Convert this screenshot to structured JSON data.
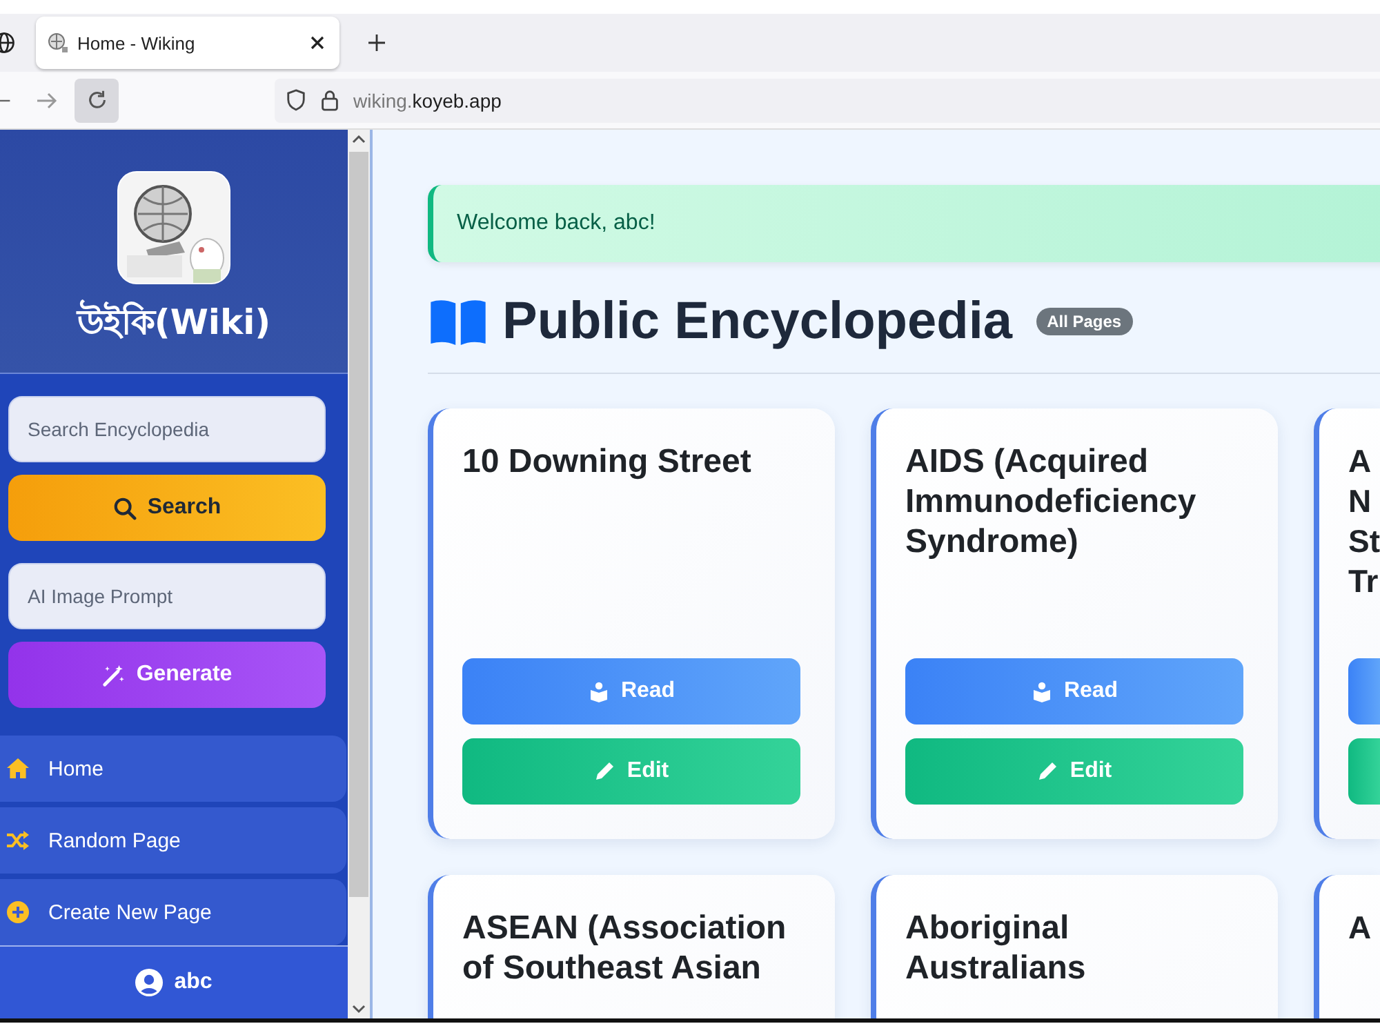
{
  "browser": {
    "tab": {
      "title": "Home - Wiking",
      "selected": true
    },
    "url": {
      "subdomain": "wiking.",
      "domain": "koyeb.app"
    }
  },
  "sidebar": {
    "title": "উইকি(Wiki)",
    "search": {
      "placeholder": "Search Encyclopedia"
    },
    "search_button": "Search",
    "prompt": {
      "placeholder": "AI Image Prompt"
    },
    "generate_button": "Generate",
    "nav": [
      {
        "kind": "home",
        "label": "Home"
      },
      {
        "kind": "random",
        "label": "Random Page"
      },
      {
        "kind": "create",
        "label": "Create New Page"
      }
    ],
    "user": "abc"
  },
  "main": {
    "alert": "Welcome back, abc!",
    "heading": "Public Encyclopedia",
    "badge": "All Pages",
    "cards": [
      {
        "title": "10 Downing Street",
        "buttons": [
          {
            "kind": "read",
            "label": "Read"
          },
          {
            "kind": "edit",
            "label": "Edit"
          }
        ]
      },
      {
        "title": "AIDS (Acquired\nImmunodeficiency\nSyndrome)",
        "buttons": [
          {
            "kind": "read",
            "label": "Read"
          },
          {
            "kind": "edit",
            "label": "Edit"
          }
        ]
      },
      {
        "title": "A\nN\nSt\nTr",
        "buttons": [
          {
            "kind": "read"
          },
          {
            "kind": "edit"
          }
        ]
      },
      {
        "title": "ASEAN (Association\nof Southeast Asian"
      },
      {
        "title": "Aboriginal\nAustralians"
      },
      {
        "title": "A"
      }
    ]
  }
}
